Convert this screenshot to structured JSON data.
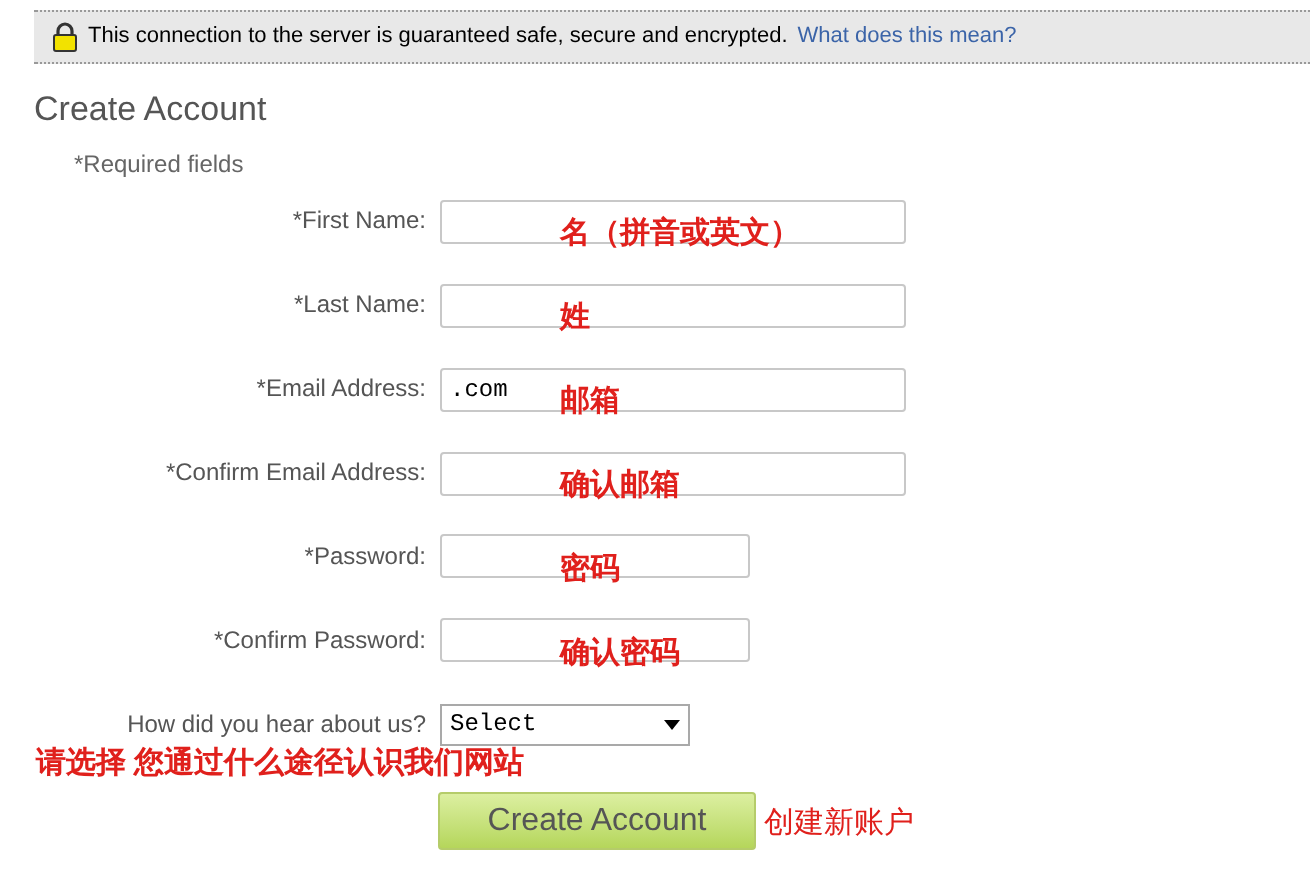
{
  "security_banner": {
    "message": "This connection to the server is guaranteed safe, secure and encrypted.",
    "link": "What does this mean?"
  },
  "title": "Create Account",
  "required_note": "*Required fields",
  "fields": [
    {
      "kind": "text",
      "label": "*First Name:",
      "note": "名（拼音或英文）"
    },
    {
      "kind": "text",
      "label": "*Last Name:",
      "note": "姓"
    },
    {
      "kind": "text",
      "label": "*Email Address:",
      "value": ".com",
      "note": "邮箱"
    },
    {
      "kind": "text",
      "label": "*Confirm Email Address:",
      "note": "确认邮箱"
    },
    {
      "kind": "password",
      "label": "*Password:",
      "note": "密码"
    },
    {
      "kind": "password",
      "label": "*Confirm Password:",
      "note": "确认密码"
    },
    {
      "kind": "select",
      "label": "How did you hear about us?",
      "value": "Select"
    }
  ],
  "select_note": "请选择 您通过什么途径认识我们网站",
  "submit": {
    "label": "Create Account",
    "note": "创建新账户"
  }
}
